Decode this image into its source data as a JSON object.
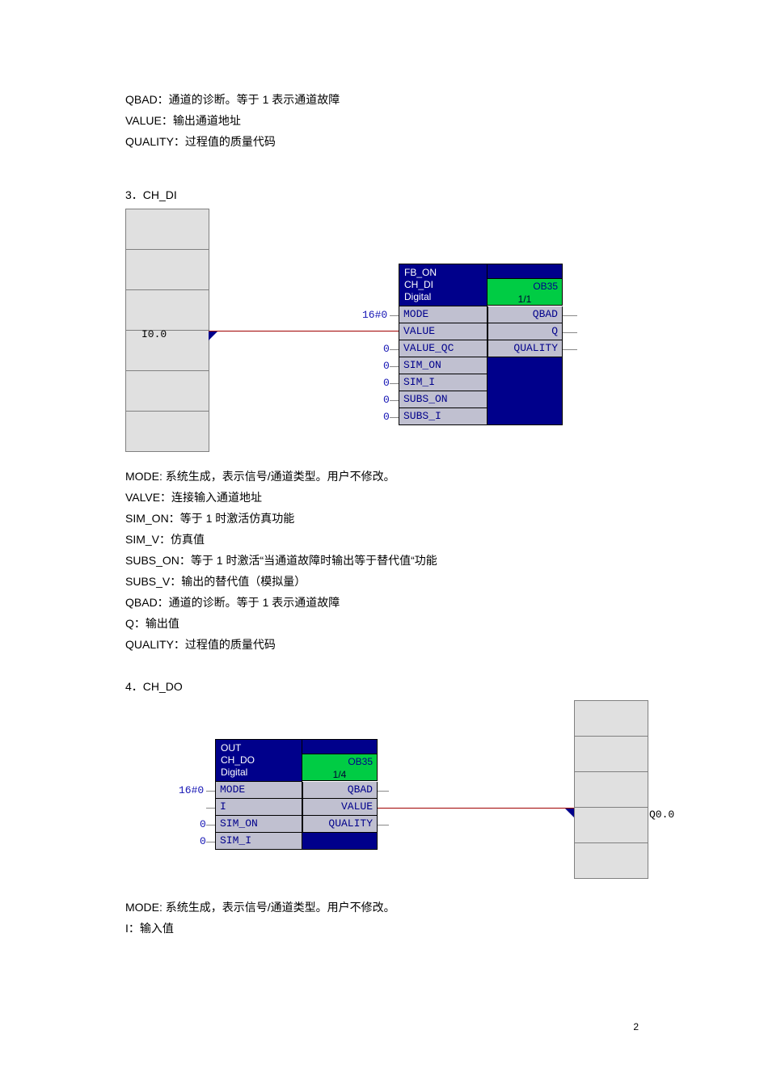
{
  "intro": {
    "l1": "QBAD：通道的诊断。等于 1 表示通道故障",
    "l2": "VALUE：输出通道地址",
    "l3": "QUALITY：过程值的质量代码"
  },
  "sect3": {
    "title": "3．CH_DI",
    "rung_addr": "I0.0",
    "fb": {
      "h1": "FB_ON",
      "h2": "CH_DI",
      "h3": "Digital",
      "status_top": "OB35",
      "status_bot": "1/1",
      "in": [
        {
          "label": "MODE",
          "val": "16#0"
        },
        {
          "label": "VALUE",
          "val": ""
        },
        {
          "label": "VALUE_QC",
          "val": "0"
        },
        {
          "label": "SIM_ON",
          "val": "0"
        },
        {
          "label": "SIM_I",
          "val": "0"
        },
        {
          "label": "SUBS_ON",
          "val": "0"
        },
        {
          "label": "SUBS_I",
          "val": "0"
        }
      ],
      "out": [
        {
          "label": "QBAD"
        },
        {
          "label": "Q"
        },
        {
          "label": "QUALITY"
        }
      ]
    },
    "desc": {
      "l1": "MODE: 系统生成，表示信号/通道类型。用户不修改。",
      "l2": "VALVE：连接输入通道地址",
      "l3": "SIM_ON：等于 1 时激活仿真功能",
      "l4": "SIM_V：仿真值",
      "l5": "SUBS_ON：等于 1 时激活“当通道故障时输出等于替代值“功能",
      "l6": "SUBS_V：输出的替代值（模拟量）",
      "l7": "QBAD：通道的诊断。等于 1 表示通道故障",
      "l8": "Q：输出值",
      "l9": "QUALITY：过程值的质量代码"
    }
  },
  "sect4": {
    "title": "4．CH_DO",
    "rung_addr": "Q0.0",
    "fb": {
      "h1": "OUT",
      "h2": "CH_DO",
      "h3": "Digital",
      "status_top": "OB35",
      "status_bot": "1/4",
      "in": [
        {
          "label": "MODE",
          "val": "16#0"
        },
        {
          "label": "I",
          "val": ""
        },
        {
          "label": "SIM_ON",
          "val": "0"
        },
        {
          "label": "SIM_I",
          "val": "0"
        }
      ],
      "out": [
        {
          "label": "QBAD"
        },
        {
          "label": "VALUE"
        },
        {
          "label": "QUALITY"
        }
      ]
    },
    "desc": {
      "l1": "MODE: 系统生成，表示信号/通道类型。用户不修改。",
      "l2": "I：输入值"
    }
  },
  "page_number": "2"
}
